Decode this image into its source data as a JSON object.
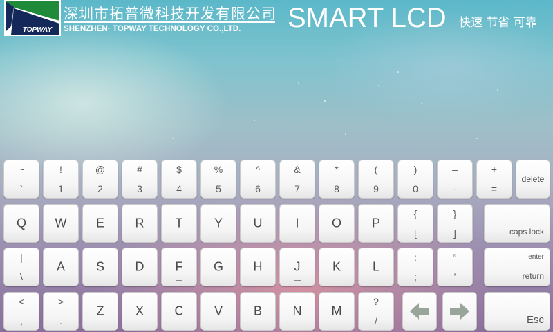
{
  "header": {
    "company_cn": "深圳市拓普微科技开发有限公司",
    "company_en": "SHENZHEN· TOPWAY TECHNOLOGY CO.,LTD.",
    "logo_text": "TOPWAY",
    "brand_title": "SMART LCD",
    "slogan": "快速 节省 可靠"
  },
  "colors": {
    "logo_green": "#1f8a3a",
    "logo_navy": "#14285a",
    "key_face": "#f4f4f4",
    "arrow_gray": "#9aa59a"
  },
  "keyboard": {
    "row1": [
      {
        "top": "~",
        "bottom": "`"
      },
      {
        "top": "!",
        "bottom": "1"
      },
      {
        "top": "@",
        "bottom": "2"
      },
      {
        "top": "#",
        "bottom": "3"
      },
      {
        "top": "$",
        "bottom": "4"
      },
      {
        "top": "%",
        "bottom": "5"
      },
      {
        "top": "^",
        "bottom": "6"
      },
      {
        "top": "&",
        "bottom": "7"
      },
      {
        "top": "*",
        "bottom": "8"
      },
      {
        "top": "(",
        "bottom": "9"
      },
      {
        "top": ")",
        "bottom": "0"
      },
      {
        "top": "–",
        "bottom": "-"
      },
      {
        "top": "+",
        "bottom": "="
      },
      {
        "label": "delete"
      }
    ],
    "row2": [
      {
        "label": "Q"
      },
      {
        "label": "W"
      },
      {
        "label": "E"
      },
      {
        "label": "R"
      },
      {
        "label": "T"
      },
      {
        "label": "Y"
      },
      {
        "label": "U"
      },
      {
        "label": "I"
      },
      {
        "label": "O"
      },
      {
        "label": "P"
      },
      {
        "top": "{",
        "bottom": "["
      },
      {
        "top": "}",
        "bottom": "]"
      },
      {
        "label": "caps lock"
      }
    ],
    "row3": [
      {
        "top": "|",
        "bottom": "\\"
      },
      {
        "label": "A"
      },
      {
        "label": "S"
      },
      {
        "label": "D"
      },
      {
        "label": "F"
      },
      {
        "label": "G"
      },
      {
        "label": "H"
      },
      {
        "label": "J"
      },
      {
        "label": "K"
      },
      {
        "label": "L"
      },
      {
        "top": ":",
        "bottom": ";"
      },
      {
        "top": "”",
        "bottom": "’"
      },
      {
        "top": "enter",
        "bottom": "return"
      }
    ],
    "row4": [
      {
        "top": "<",
        "bottom": ","
      },
      {
        "top": ">",
        "bottom": "."
      },
      {
        "label": "Z"
      },
      {
        "label": "X"
      },
      {
        "label": "C"
      },
      {
        "label": "V"
      },
      {
        "label": "B"
      },
      {
        "label": "N"
      },
      {
        "label": "M"
      },
      {
        "top": "?",
        "bottom": "/"
      },
      {
        "icon": "left-arrow-icon"
      },
      {
        "icon": "right-arrow-icon"
      },
      {
        "label": "Esc"
      }
    ]
  }
}
